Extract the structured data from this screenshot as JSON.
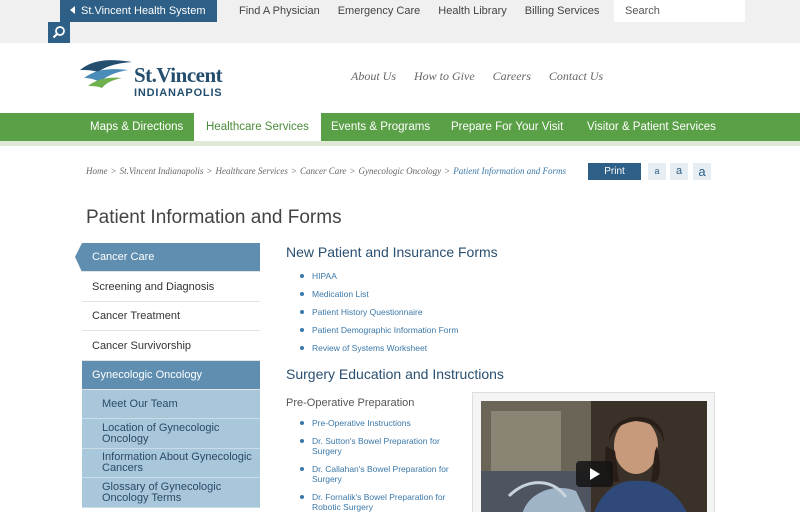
{
  "utility": {
    "system_label": "St.Vincent Health System",
    "links": [
      "Find A Physician",
      "Emergency Care",
      "Health Library",
      "Billing Services"
    ],
    "search_placeholder": "Search"
  },
  "header": {
    "logo_name": "St.Vincent",
    "logo_sub": "INDIANAPOLIS",
    "links": [
      "About Us",
      "How to Give",
      "Careers",
      "Contact Us"
    ]
  },
  "nav": {
    "items": [
      "Maps & Directions",
      "Healthcare Services",
      "Events & Programs",
      "Prepare For Your Visit",
      "Visitor & Patient Services"
    ],
    "active_index": 1
  },
  "breadcrumb": {
    "items": [
      "Home",
      "St.Vincent Indianapolis",
      "Healthcare Services",
      "Cancer Care",
      "Gynecologic Oncology"
    ],
    "current": "Patient Information and Forms",
    "separator": ">"
  },
  "tools": {
    "print_label": "Print",
    "text_sizes": [
      "a",
      "a",
      "a"
    ]
  },
  "page_title": "Patient Information and Forms",
  "sidebar": {
    "items": [
      {
        "label": "Cancer Care",
        "type": "head"
      },
      {
        "label": "Screening and Diagnosis",
        "type": "normal"
      },
      {
        "label": "Cancer Treatment",
        "type": "normal"
      },
      {
        "label": "Cancer Survivorship",
        "type": "normal"
      },
      {
        "label": "Gynecologic Oncology",
        "type": "sub"
      },
      {
        "label": "Meet Our Team",
        "type": "light"
      },
      {
        "label": "Location of Gynecologic Oncology",
        "type": "light"
      },
      {
        "label": "Information About Gynecologic Cancers",
        "type": "light"
      },
      {
        "label": "Glossary of Gynecologic Oncology Terms",
        "type": "light"
      }
    ]
  },
  "content": {
    "section1": {
      "title": "New Patient and Insurance Forms",
      "links": [
        "HIPAA",
        "Medication List",
        "Patient History Questionnaire",
        "Patient Demographic Information Form",
        "Review of Systems Worksheet"
      ]
    },
    "section2": {
      "title": "Surgery Education and Instructions",
      "subhead": "Pre-Operative Preparation",
      "links": [
        "Pre-Operative Instructions",
        "Dr. Sutton's Bowel Preparation for Surgery",
        "Dr. Callahan's Bowel Preparation for Surgery",
        "Dr. Fornalik's Bowel Preparation for Robotic Surgery"
      ]
    }
  },
  "colors": {
    "brand_blue": "#2e5f86",
    "nav_green": "#5aa046",
    "link_blue": "#3b78a8",
    "sidebar_blue": "#5f8eb0",
    "sidebar_light": "#a9c7db"
  }
}
